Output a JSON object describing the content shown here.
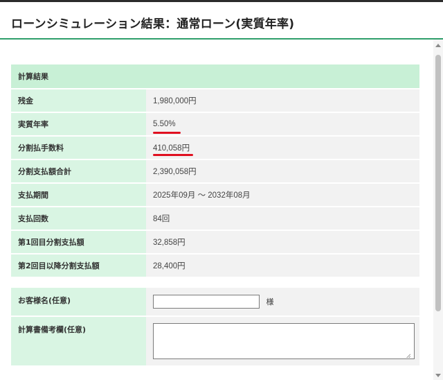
{
  "page": {
    "title": "ローンシミュレーション結果：通常ローン(実質年率)"
  },
  "result": {
    "header": "計算結果",
    "rows": [
      {
        "label": "残金",
        "value": "1,980,000円"
      },
      {
        "label": "実質年率",
        "value": "5.50%"
      },
      {
        "label": "分割払手数料",
        "value": "410,058円"
      },
      {
        "label": "分割支払額合計",
        "value": "2,390,058円"
      },
      {
        "label": "支払期間",
        "value": "2025年09月 ～ 2032年08月"
      },
      {
        "label": "支払回数",
        "value": "84回"
      },
      {
        "label": "第1回目分割支払額",
        "value": "32,858円"
      },
      {
        "label": "第2回目以降分割支払額",
        "value": "28,400円"
      }
    ]
  },
  "form": {
    "customer_name_label": "お客様名(任意)",
    "customer_name_value": "",
    "customer_name_suffix": "様",
    "memo_label": "計算書備考欄(任意)",
    "memo_value": ""
  },
  "colors": {
    "accent": "#2e9e6a",
    "label_bg": "#d9f5e3",
    "highlight": "#e01020"
  }
}
